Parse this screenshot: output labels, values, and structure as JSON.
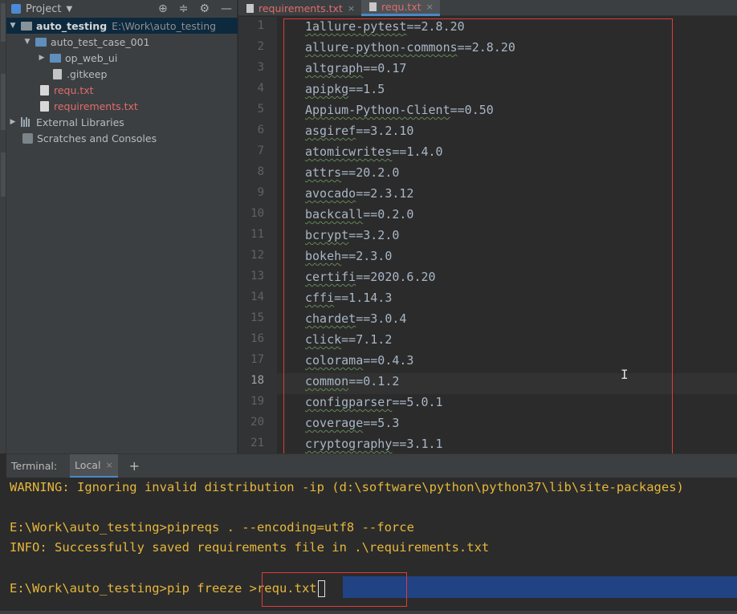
{
  "project_panel": {
    "title": "Project",
    "root": {
      "name": "auto_testing",
      "path": "E:\\Work\\auto_testing"
    },
    "items": [
      {
        "label": "auto_test_case_001"
      },
      {
        "label": "op_web_ui"
      },
      {
        "label": ".gitkeep"
      },
      {
        "label": "requ.txt"
      },
      {
        "label": "requirements.txt"
      },
      {
        "label": "External Libraries"
      },
      {
        "label": "Scratches and Consoles"
      }
    ]
  },
  "tabs": [
    {
      "label": "requirements.txt",
      "close": "×"
    },
    {
      "label": "requ.txt",
      "close": "×"
    }
  ],
  "editor": {
    "lines": [
      {
        "num": "1",
        "pkg": "1allure-pytest",
        "ver": "==2.8.20"
      },
      {
        "num": "2",
        "pkg": "allure-python-commons",
        "ver": "==2.8.20"
      },
      {
        "num": "3",
        "pkg": "altgraph",
        "ver": "==0.17"
      },
      {
        "num": "4",
        "pkg": "apipkg",
        "ver": "==1.5"
      },
      {
        "num": "5",
        "pkg": "Appium-Python-Client",
        "ver": "==0.50"
      },
      {
        "num": "6",
        "pkg": "asgiref",
        "ver": "==3.2.10"
      },
      {
        "num": "7",
        "pkg": "atomicwrites",
        "ver": "==1.4.0"
      },
      {
        "num": "8",
        "pkg": "attrs",
        "ver": "==20.2.0"
      },
      {
        "num": "9",
        "pkg": "avocado",
        "ver": "==2.3.12"
      },
      {
        "num": "10",
        "pkg": "backcall",
        "ver": "==0.2.0"
      },
      {
        "num": "11",
        "pkg": "bcrypt",
        "ver": "==3.2.0"
      },
      {
        "num": "12",
        "pkg": "bokeh",
        "ver": "==2.3.0"
      },
      {
        "num": "13",
        "pkg": "certifi",
        "ver": "==2020.6.20"
      },
      {
        "num": "14",
        "pkg": "cffi",
        "ver": "==1.14.3"
      },
      {
        "num": "15",
        "pkg": "chardet",
        "ver": "==3.0.4"
      },
      {
        "num": "16",
        "pkg": "click",
        "ver": "==7.1.2"
      },
      {
        "num": "17",
        "pkg": "colorama",
        "ver": "==0.4.3"
      },
      {
        "num": "18",
        "pkg": "common",
        "ver": "==0.1.2"
      },
      {
        "num": "19",
        "pkg": "configparser",
        "ver": "==5.0.1"
      },
      {
        "num": "20",
        "pkg": "coverage",
        "ver": "==5.3"
      },
      {
        "num": "21",
        "pkg": "cryptography",
        "ver": "==3.1.1"
      }
    ]
  },
  "terminal": {
    "title": "Terminal:",
    "tab_label": "Local",
    "tab_close": "×",
    "add": "+",
    "lines": [
      "WARNING: Ignoring invalid distribution -ip (d:\\software\\python\\python37\\lib\\site-packages)",
      "E:\\Work\\auto_testing>pipreqs . --encoding=utf8 --force",
      "INFO: Successfully saved requirements file in .\\requirements.txt"
    ],
    "prompt": "E:\\Work\\auto_testing>pip freeze ",
    "command": ">requ.txt"
  }
}
